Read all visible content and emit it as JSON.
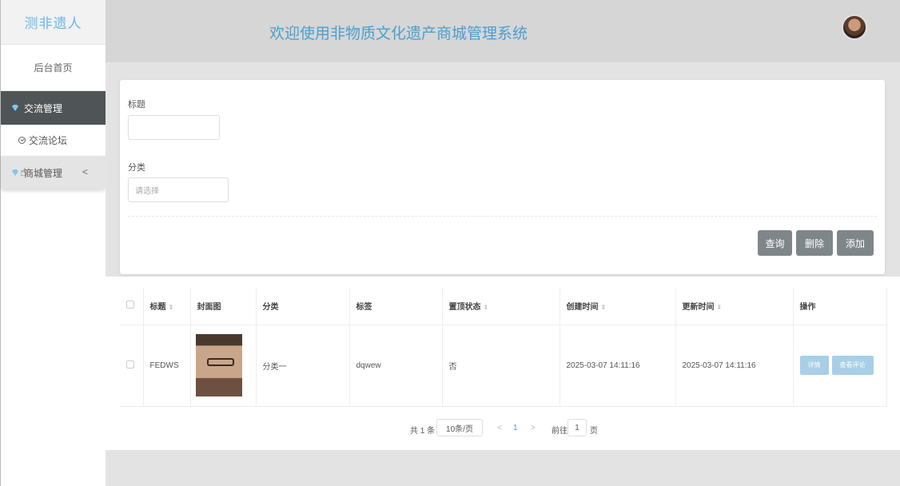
{
  "sidebar": {
    "logo": "测非遗人",
    "home": "后台首页",
    "exchange_group": "交流管理",
    "forum": "交流论坛",
    "mall_group": "商城管理",
    "mall_arrow": "<"
  },
  "header": {
    "title": "欢迎使用非物质文化遗产商城管理系统"
  },
  "search": {
    "title_label": "标题",
    "title_value": "",
    "category_label": "分类",
    "category_placeholder": "请选择",
    "query_button": "查询",
    "delete_button": "删除",
    "add_button": "添加"
  },
  "table": {
    "columns": [
      "标题",
      "封面图",
      "分类",
      "标签",
      "置顶状态",
      "创建时间",
      "更新时间",
      "操作"
    ],
    "rows": [
      {
        "title": "FEDWS",
        "category": "分类一",
        "tag": "dqwew",
        "top": "否",
        "created": "2025-03-07 14:11:16",
        "updated": "2025-03-07 14:11:16",
        "detail": "详情",
        "comments": "查看评论"
      }
    ]
  },
  "pagination": {
    "total": "共 1 条",
    "page_size": "10条/页",
    "prev": "<",
    "current": "1",
    "next": ">",
    "goto_label": "前往",
    "goto_value": "1",
    "page_suffix": "页"
  },
  "colors": {
    "accent": "#4a9fd0",
    "logo": "#6ab7e8",
    "active_menu": "#4f5557",
    "button": "#7f868a",
    "op_button": "#a8cfe6"
  }
}
